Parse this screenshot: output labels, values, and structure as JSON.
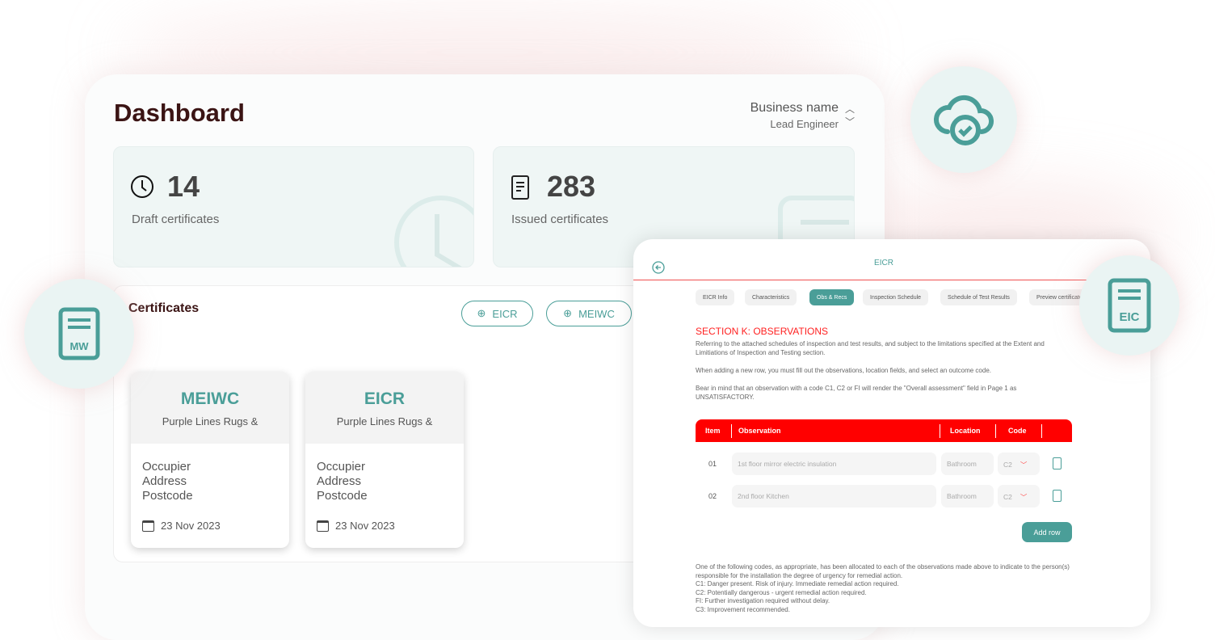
{
  "dashboard": {
    "title": "Dashboard",
    "business_name": "Business name",
    "role": "Lead Engineer",
    "stats": [
      {
        "value": "14",
        "label": "Draft certificates",
        "icon": "clock-icon"
      },
      {
        "value": "283",
        "label": "Issued certificates",
        "icon": "document-icon"
      }
    ],
    "certificates_title": "Certificates",
    "buttons": [
      {
        "label": "EICR"
      },
      {
        "label": "MEIWC"
      }
    ],
    "cards": [
      {
        "type": "MEIWC",
        "company": "Purple Lines Rugs &",
        "occupier": "Occupier",
        "address": "Address",
        "postcode": "Postcode",
        "date": "23 Nov 2023"
      },
      {
        "type": "EICR",
        "company": "Purple Lines Rugs &",
        "occupier": "Occupier",
        "address": "Address",
        "postcode": "Postcode",
        "date": "23 Nov 2023"
      }
    ]
  },
  "badges": {
    "mw": "MW",
    "eic": "EIC"
  },
  "form": {
    "title": "EICR",
    "tabs": [
      "EICR Info",
      "Characteristics",
      "Obs & Recs",
      "Inspection Schedule",
      "Schedule of Test Results",
      "Preview certificate"
    ],
    "active_tab": "Obs & Recs",
    "section_title": "SECTION K: OBSERVATIONS",
    "para1": "Referring to the attached schedules of inspection and test results, and subject to the limitations specified at the Extent and Limitiations of Inspection and Testing section.",
    "para2": "When adding a new row, you must fill out the observations, location fields, and select an outcome code.",
    "para3": "Bear in mind that an observation with a code C1, C2 or FI will render the \"Overall assessment\" field in Page 1 as UNSATISFACTORY.",
    "columns": [
      "Item",
      "Observation",
      "Location",
      "Code"
    ],
    "rows": [
      {
        "item": "01",
        "observation": "1st floor mirror electric insulation",
        "location": "Bathroom",
        "code": "C2"
      },
      {
        "item": "02",
        "observation": "2nd floor Kitchen",
        "location": "Bathroom",
        "code": "C2"
      }
    ],
    "add_row": "Add row",
    "footer": [
      "One of the following codes, as appropriate, has been allocated to each of the observations made above to indicate to the person(s) responsible for the installation the degree of urgency for remedial action.",
      "C1: Danger present. Risk of injury. Immediate remedial action required.",
      "C2: Potentially dangerous - urgent remedial action required.",
      "FI: Further investigation required without delay.",
      "C3: Improvement recommended."
    ]
  },
  "colors": {
    "teal": "#4a9e98",
    "red": "#ff0000",
    "title": "#3b1414"
  }
}
